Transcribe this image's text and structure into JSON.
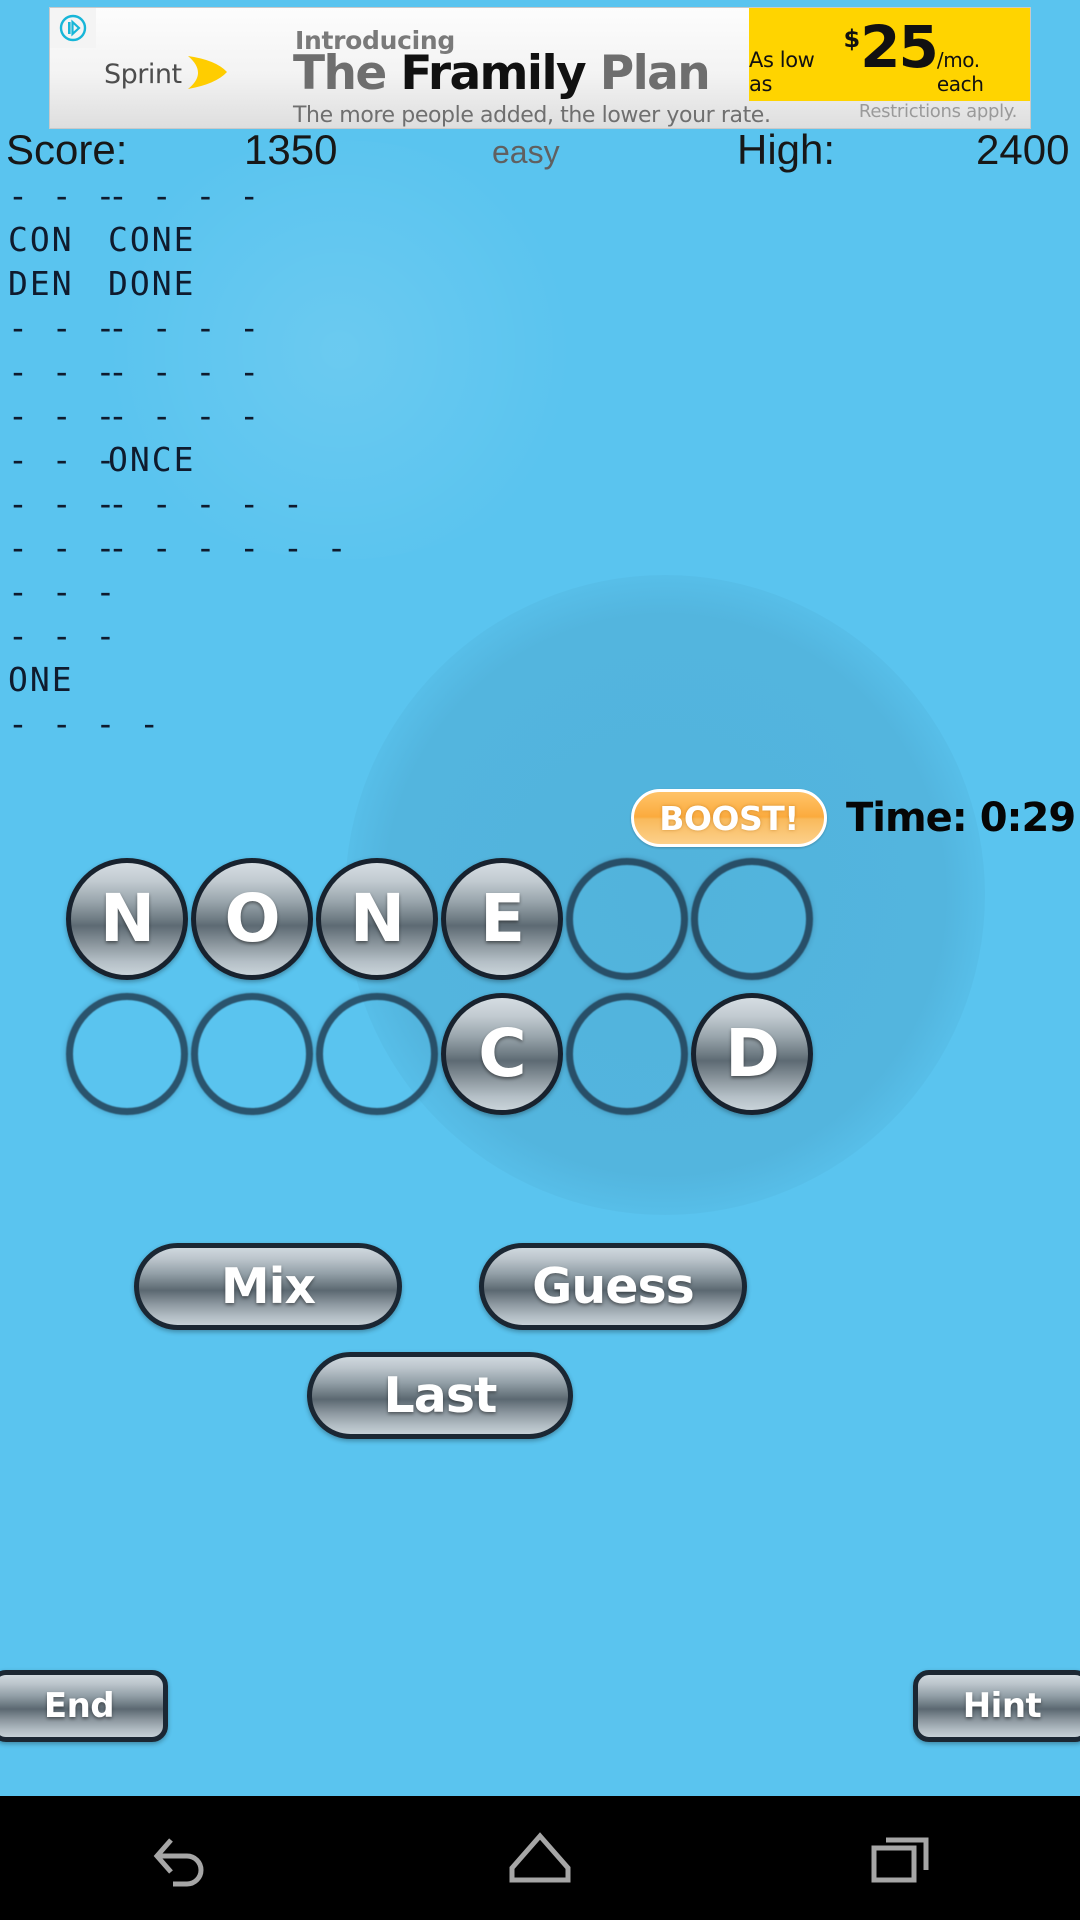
{
  "ad": {
    "advertiser": "Sprint",
    "intro": "Introducing",
    "headline_light": "The ",
    "headline_bold": "Framily",
    "headline_light2": " Plan",
    "subhead": "The more people added, the lower your rate.",
    "restrictions": "Restrictions apply.",
    "price_prefix": "As low as",
    "price_dollar": "$",
    "price_amount": "25",
    "price_suffix": "/mo. each",
    "choice_icon": "ad-choices-icon"
  },
  "scorebar": {
    "score_label": "Score:",
    "score_value": "1350",
    "difficulty": "easy",
    "high_label": "High:",
    "high_value": "2400"
  },
  "wordlist": {
    "rows": [
      {
        "col1": "- - -",
        "col2": "- - - -"
      },
      {
        "col1": "CON",
        "col2": "CONE"
      },
      {
        "col1": "DEN",
        "col2": "DONE"
      },
      {
        "col1": "- - -",
        "col2": "- - - -"
      },
      {
        "col1": "- - -",
        "col2": "- - - -"
      },
      {
        "col1": "- - -",
        "col2": "- - - -"
      },
      {
        "col1": "- - -",
        "col2": "ONCE"
      },
      {
        "col1": "- - -",
        "col2": "- - - - -"
      },
      {
        "col1": "- - -",
        "col2": "- - - - - -"
      },
      {
        "col1": "- - -",
        "col2": ""
      },
      {
        "col1": "- - -",
        "col2": ""
      },
      {
        "col1": "ONE",
        "col2": ""
      },
      {
        "col1": "- - - -",
        "col2": ""
      }
    ]
  },
  "boost": {
    "label": "BOOST!"
  },
  "timer": {
    "text": "Time: 0:29"
  },
  "tiles": {
    "row0": [
      {
        "letter": "N",
        "state": "filled"
      },
      {
        "letter": "O",
        "state": "filled"
      },
      {
        "letter": "N",
        "state": "filled"
      },
      {
        "letter": "E",
        "state": "filled"
      },
      {
        "letter": "",
        "state": "empty"
      },
      {
        "letter": "",
        "state": "empty"
      }
    ],
    "row1": [
      {
        "letter": "",
        "state": "empty"
      },
      {
        "letter": "",
        "state": "empty"
      },
      {
        "letter": "",
        "state": "empty"
      },
      {
        "letter": "C",
        "state": "filled"
      },
      {
        "letter": "",
        "state": "empty"
      },
      {
        "letter": "D",
        "state": "filled"
      }
    ]
  },
  "actions": {
    "mix": "Mix",
    "guess": "Guess",
    "last": "Last",
    "end": "End",
    "hint": "Hint"
  },
  "navbar": {
    "back": "back-icon",
    "home": "home-icon",
    "recents": "recents-icon"
  },
  "colors": {
    "background": "#5ac4ef",
    "boost_accent": "#fbab3e",
    "ad_yellow": "#ffd400",
    "tile_border": "#18222e",
    "text_dark": "#171717"
  }
}
